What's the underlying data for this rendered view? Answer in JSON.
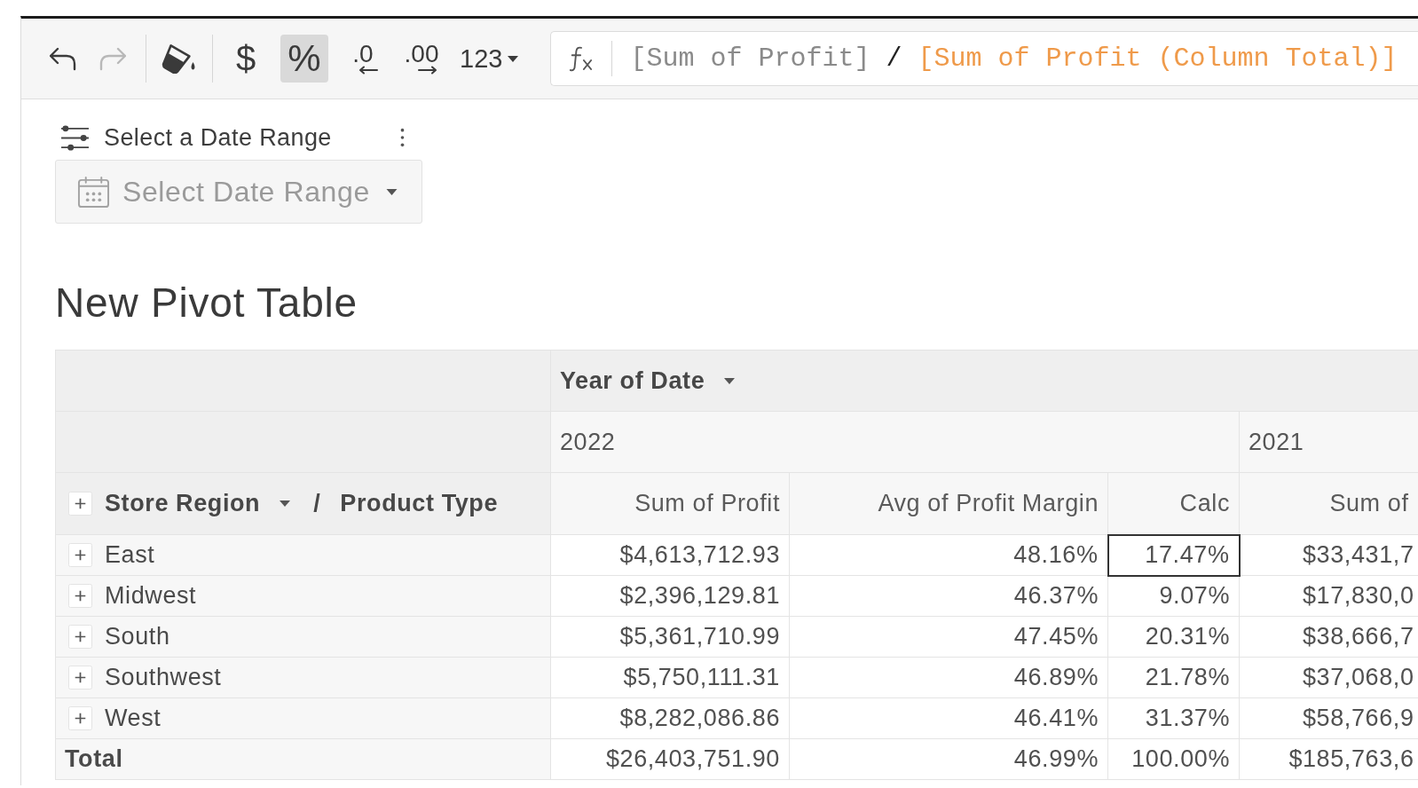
{
  "toolbar": {
    "groups": [
      [
        {
          "kind": "undo",
          "selected": false,
          "disabled": false
        },
        {
          "kind": "redo",
          "selected": false,
          "disabled": true
        }
      ],
      [
        {
          "kind": "fill",
          "selected": false,
          "disabled": false
        }
      ],
      [
        {
          "kind": "currency",
          "label": "$",
          "selected": false,
          "disabled": false
        },
        {
          "kind": "percent",
          "label": "%",
          "selected": true,
          "disabled": false
        },
        {
          "kind": "decrease-decimals",
          "label": ".0",
          "selected": false,
          "disabled": false
        },
        {
          "kind": "increase-decimals",
          "label": ".00",
          "selected": false,
          "disabled": false
        },
        {
          "kind": "number-format",
          "label": "123",
          "selected": false,
          "disabled": false
        }
      ]
    ]
  },
  "formula_bar": {
    "tokens": [
      {
        "text": "[Sum of Profit]",
        "color": "#8a8a8a"
      },
      {
        "text": "/",
        "color": "#222222"
      },
      {
        "text": "[Sum of Profit (Column Total)]",
        "color": "#ef9a4a"
      }
    ]
  },
  "date_filter": {
    "title": "Select a Date Range",
    "placeholder": "Select Date Range"
  },
  "pivot": {
    "title": "New Pivot Table",
    "column_field": {
      "label": "Year of Date",
      "has_menu": true
    },
    "row_header": {
      "expanded": false,
      "separator": "/",
      "fields": [
        {
          "label": "Store Region",
          "has_menu": true
        },
        {
          "label": "Product Type",
          "has_menu": false
        }
      ]
    },
    "years": [
      {
        "label": "2022",
        "columns": [
          "Sum of Profit",
          "Avg of Profit Margin",
          "Calc"
        ]
      },
      {
        "label": "2021",
        "columns": [
          "Sum of"
        ]
      }
    ],
    "rows": [
      {
        "kind": "group",
        "label": "East",
        "expanded": false,
        "cells": [
          {
            "text": "$4,613,712.93",
            "selected": false
          },
          {
            "text": "48.16%",
            "selected": false
          },
          {
            "text": "17.47%",
            "selected": true
          },
          {
            "text": "$33,431,7",
            "selected": false
          }
        ]
      },
      {
        "kind": "group",
        "label": "Midwest",
        "expanded": false,
        "cells": [
          {
            "text": "$2,396,129.81",
            "selected": false
          },
          {
            "text": "46.37%",
            "selected": false
          },
          {
            "text": "9.07%",
            "selected": false
          },
          {
            "text": "$17,830,0",
            "selected": false
          }
        ]
      },
      {
        "kind": "group",
        "label": "South",
        "expanded": false,
        "cells": [
          {
            "text": "$5,361,710.99",
            "selected": false
          },
          {
            "text": "47.45%",
            "selected": false
          },
          {
            "text": "20.31%",
            "selected": false
          },
          {
            "text": "$38,666,7",
            "selected": false
          }
        ]
      },
      {
        "kind": "group",
        "label": "Southwest",
        "expanded": false,
        "cells": [
          {
            "text": "$5,750,111.31",
            "selected": false
          },
          {
            "text": "46.89%",
            "selected": false
          },
          {
            "text": "21.78%",
            "selected": false
          },
          {
            "text": "$37,068,0",
            "selected": false
          }
        ]
      },
      {
        "kind": "group",
        "label": "West",
        "expanded": false,
        "cells": [
          {
            "text": "$8,282,086.86",
            "selected": false
          },
          {
            "text": "46.41%",
            "selected": false
          },
          {
            "text": "31.37%",
            "selected": false
          },
          {
            "text": "$58,766,9",
            "selected": false
          }
        ]
      },
      {
        "kind": "total",
        "label": "Total",
        "cells": [
          {
            "text": "$26,403,751.90",
            "selected": false
          },
          {
            "text": "46.99%",
            "selected": false
          },
          {
            "text": "100.00%",
            "selected": false
          },
          {
            "text": "$185,763,6",
            "selected": false
          }
        ]
      }
    ]
  }
}
